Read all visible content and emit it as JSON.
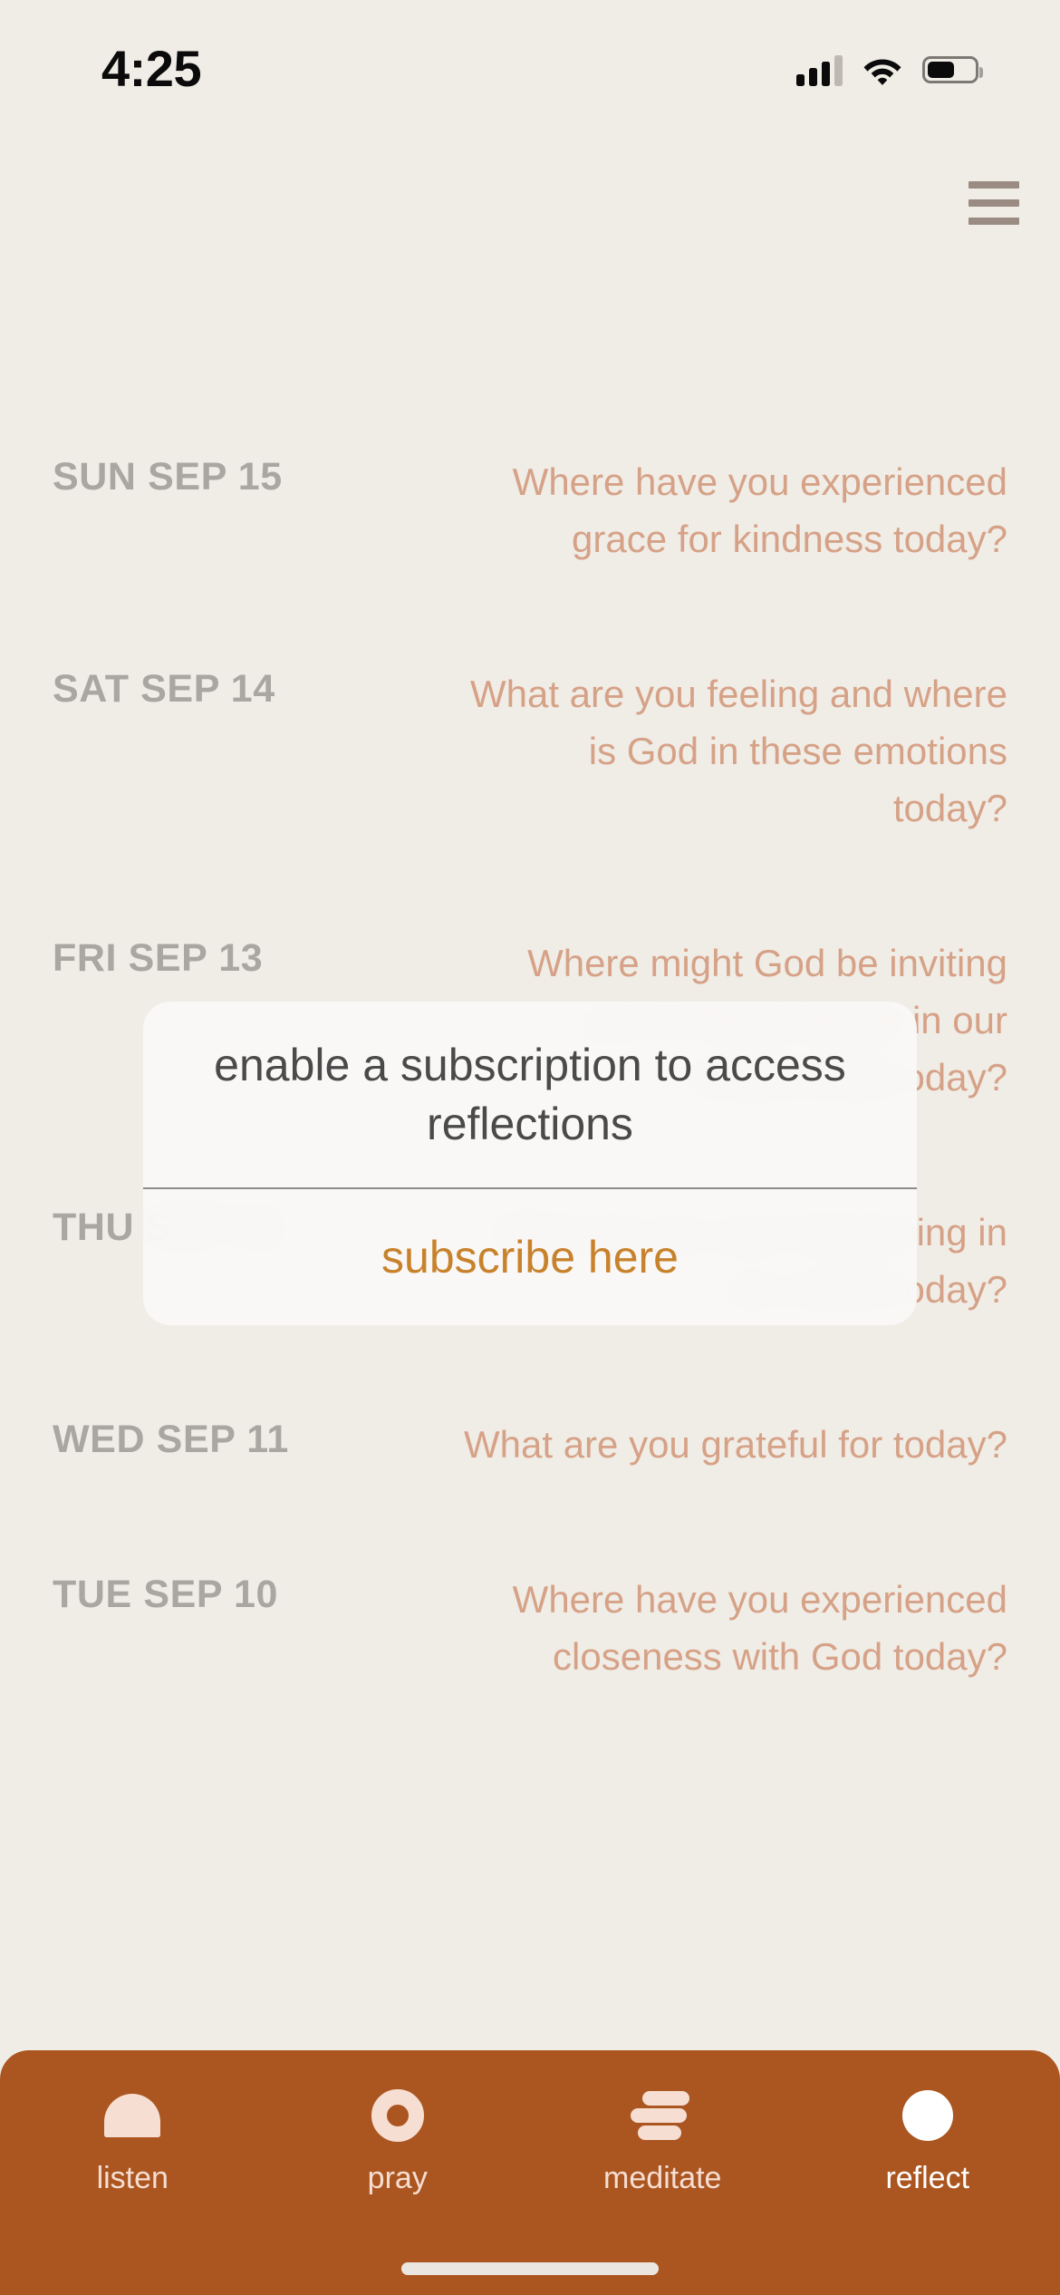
{
  "status_bar": {
    "time": "4:25",
    "signal_icon": "cellular-signal-icon",
    "wifi_icon": "wifi-icon",
    "battery_icon": "battery-icon"
  },
  "header": {
    "menu_icon": "hamburger-menu-icon"
  },
  "reflections": [
    {
      "date": "SUN SEP 15",
      "question": "Where have you experienced grace for kindness today?"
    },
    {
      "date": "SAT SEP 14",
      "question": "What are you feeling and where is God in these emotions today?"
    },
    {
      "date": "FRI SEP 13",
      "question": "Where might God be inviting you to move closer in our relationship today?"
    },
    {
      "date": "THU SEP 12",
      "question": "What do you see God doing in our world today?"
    },
    {
      "date": "WED SEP 11",
      "question": "What are you grateful for today?"
    },
    {
      "date": "TUE SEP 10",
      "question": "Where have you experienced closeness with God today?"
    }
  ],
  "modal": {
    "message": "enable a subscription to access reflections",
    "action_label": "subscribe here"
  },
  "tabbar": {
    "items": [
      {
        "label": "listen",
        "icon": "dome-icon",
        "active": false
      },
      {
        "label": "pray",
        "icon": "ring-icon",
        "active": false
      },
      {
        "label": "meditate",
        "icon": "stacked-bars-icon",
        "active": false
      },
      {
        "label": "reflect",
        "icon": "filled-circle-icon",
        "active": true
      }
    ]
  },
  "colors": {
    "background": "#f0ece6",
    "accent": "#ab5620",
    "question_text": "#d6a287",
    "date_text": "#aaa7a2",
    "link": "#c8822c",
    "icon_tint": "#f6ded2"
  }
}
